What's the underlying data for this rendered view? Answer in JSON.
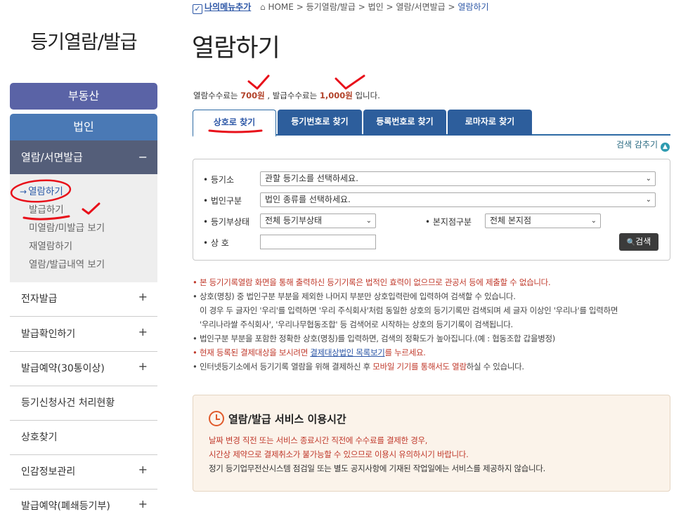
{
  "sidebar": {
    "title": "등기열람/발급",
    "cat_realestate": "부동산",
    "cat_corp": "법인",
    "sub_header": "열람/서면발급",
    "sub_header_toggle": "−",
    "sub_items": [
      "열람하기",
      "발급하기",
      "미열람/미발급 보기",
      "재열람하기",
      "열람/발급내역 보기"
    ],
    "active_arrow": "→",
    "menu": [
      {
        "label": "전자발급",
        "toggle": "+"
      },
      {
        "label": "발급확인하기",
        "toggle": "+"
      },
      {
        "label": "발급예약(30통이상)",
        "toggle": "+"
      },
      {
        "label": "등기신청사건 처리현황",
        "toggle": ""
      },
      {
        "label": "상호찾기",
        "toggle": ""
      },
      {
        "label": "인감정보관리",
        "toggle": "+"
      },
      {
        "label": "발급예약(폐쇄등기부)",
        "toggle": "+"
      }
    ]
  },
  "top": {
    "my_menu": "나의메뉴추가",
    "check": "✓",
    "home_icon": "⌂",
    "breadcrumb": [
      "HOME",
      "등기열람/발급",
      "법인",
      "열람/서면발급",
      "열람하기"
    ],
    "sep": ">"
  },
  "page": {
    "title": "열람하기",
    "fee_pre": "열람수수료는 ",
    "fee_view": "700원",
    "fee_mid": " , 발급수수료는 ",
    "fee_issue": "1,000원",
    "fee_post": " 입니다."
  },
  "tabs": [
    "상호로 찾기",
    "등기번호로 찾기",
    "등록번호로 찾기",
    "로마자로 찾기"
  ],
  "collapse": "검색 감추기",
  "collapse_icon": "▲",
  "form": {
    "registry_label": "• 등기소",
    "registry_value": "관할 등기소를 선택하세요.",
    "type_label": "• 법인구분",
    "type_value": "법인 종류를 선택하세요.",
    "status_label": "• 등기부상태",
    "status_value": "전체 등기부상태",
    "branch_label": "• 본지점구분",
    "branch_value": "전체 본지점",
    "name_label": "• 상 호",
    "name_value": "",
    "dropdown_icon": "⌄",
    "search_button": "검색",
    "search_icon": "🔍"
  },
  "notices": {
    "bullet": "•",
    "n1": "본 등기기록열람 화면을 통해 출력하신 등기기록은 법적인 효력이 없으므로 관공서 등에 제출할 수 없습니다.",
    "n2a": "상호(명칭) 중 법인구분 부분을 제외한 나머지 부분만 상호입력란에 입력하여 검색할 수 있습니다.",
    "n2b": "이 경우 두 글자인 '우리'를 입력하면 '우리 주식회사'처럼 동일한 상호의 등기기록만 검색되며 세 글자 이상인 '우리나'를 입력하면",
    "n2c": "'우리나라쌀 주식회사', '우리나무협동조합' 등 검색어로 시작하는 상호의 등기기록이 검색됩니다.",
    "n3": "법인구분 부분을 포함한 정확한 상호(명칭)를 입력하면, 검색의 정확도가 높아집니다.(예 : 협동조합 갑을병정)",
    "n4a": "현재 등록된 결제대상을 보시려면 ",
    "n4b": "결제대상법인 목록보기",
    "n4c": "를 누르세요.",
    "n5a": "인터넷등기소에서 등기기록 열람을 위해 결제하신 후 ",
    "n5b": "모바일 기기를 통해서도 열람",
    "n5c": "하실 수 있습니다."
  },
  "service": {
    "title": "열람/발급 서비스 이용시간",
    "line1": "날짜 변경 직전 또는 서비스 종료시간 직전에 수수료를 결제한 경우,",
    "line2": "시간상 제약으로 결제취소가 불가능할 수 있으므로 이용시 유의하시기 바랍니다.",
    "line3": "정기 등기업무전산시스템 점검일 또는 별도 공지사항에 기재된 작업일에는 서비스를 제공하지 않습니다."
  },
  "colors": {
    "annotation": "#e8101a",
    "tab_blue": "#2d5e9c",
    "sidebar_dark": "#545e79",
    "fee_red": "#b2432a"
  }
}
